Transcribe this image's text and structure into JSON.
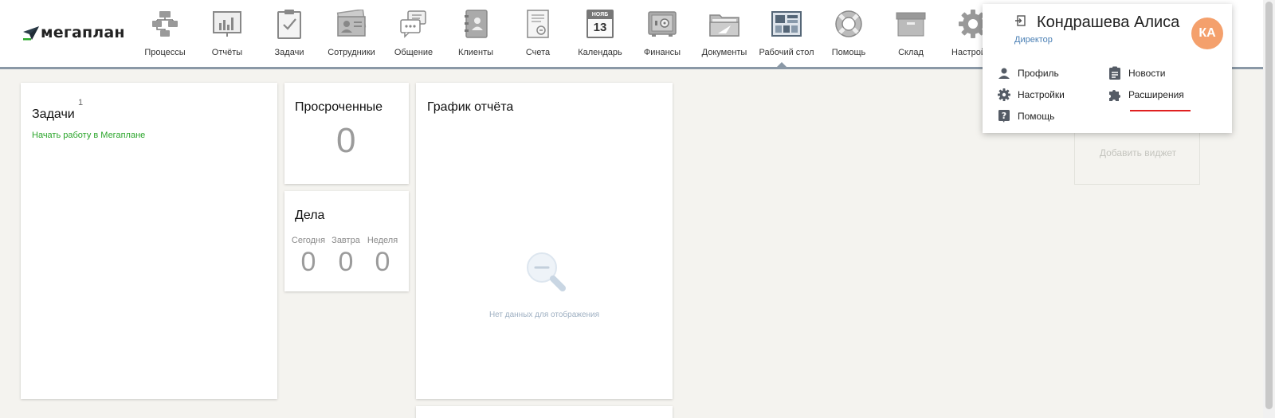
{
  "logo": {
    "text": "мегаплан"
  },
  "nav": {
    "processes": "Процессы",
    "reports": "Отчёты",
    "tasks": "Задачи",
    "employees": "Сотрудники",
    "communication": "Общение",
    "clients": "Клиенты",
    "invoices": "Счета",
    "calendar": "Календарь",
    "calendar_month": "НОЯБ",
    "calendar_day": "13",
    "finance": "Финансы",
    "documents": "Документы",
    "desktop": "Рабочий стол",
    "help": "Помощь",
    "warehouse": "Склад",
    "settings": "Настройки",
    "active": "desktop"
  },
  "widgets": {
    "tasks": {
      "title": "Задачи",
      "count": "1",
      "link": "Начать работу в Мегаплане"
    },
    "overdue": {
      "title": "Просроченные",
      "value": "0"
    },
    "deals": {
      "title": "Дела",
      "today_label": "Сегодня",
      "today_value": "0",
      "tomorrow_label": "Завтра",
      "tomorrow_value": "0",
      "week_label": "Неделя",
      "week_value": "0"
    },
    "report_chart": {
      "title": "График отчёта",
      "empty_text": "Нет данных для отображения"
    },
    "add_widget": "Добавить виджет"
  },
  "user_menu": {
    "name": "Кондрашева Алиса",
    "role": "Директор",
    "initials": "КА",
    "avatar_color": "#f4a06c",
    "items": {
      "profile": "Профиль",
      "news": "Новости",
      "settings": "Настройки",
      "extensions": "Расширения",
      "help": "Помощь"
    }
  },
  "colors": {
    "link_green": "#2aa52a",
    "role_blue": "#4b80b5",
    "nav_line": "#8a98a6",
    "underline_red": "#e02020"
  }
}
